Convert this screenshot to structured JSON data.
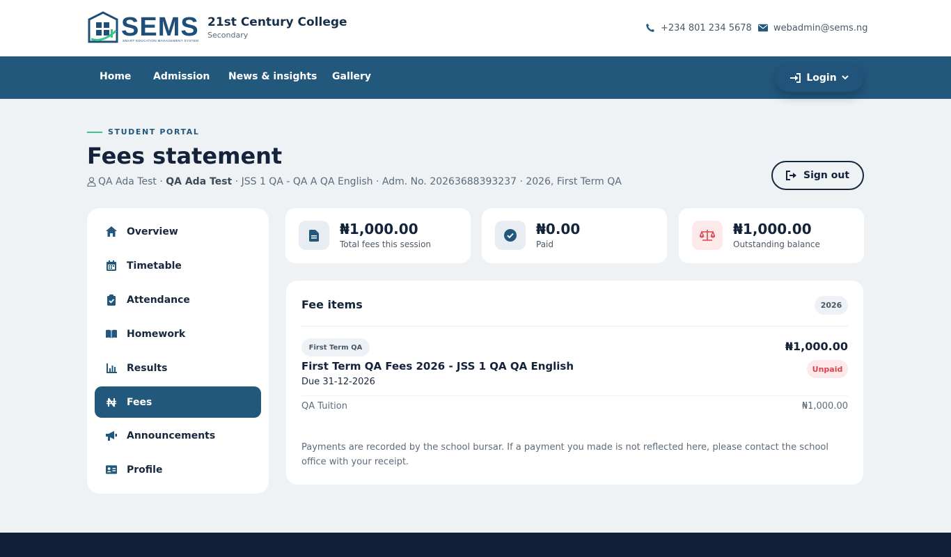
{
  "brand": {
    "logo_text": "SEMS",
    "logo_subtext": "SMART EDUCATION MANAGEMENT SYSTEM",
    "college_name": "21st Century College",
    "college_level": "Secondary"
  },
  "contact": {
    "phone": "+234 801 234 5678",
    "email": "webadmin@sems.ng"
  },
  "nav": {
    "items": [
      "Home",
      "Admission",
      "News & insights",
      "Gallery"
    ],
    "login_label": "Login"
  },
  "header": {
    "eyebrow": "STUDENT PORTAL",
    "title": "Fees statement",
    "student_name": "QA Ada Test",
    "student_name_bold": "QA Ada Test",
    "details": "· JSS 1 QA - QA A QA English · Adm. No. 20263688393237 · 2026, First Term QA",
    "signout_label": "Sign out"
  },
  "sidebar": {
    "items": [
      {
        "label": "Overview",
        "icon": "home-icon"
      },
      {
        "label": "Timetable",
        "icon": "calendar-icon"
      },
      {
        "label": "Attendance",
        "icon": "clipboard-check-icon"
      },
      {
        "label": "Homework",
        "icon": "book-open-icon"
      },
      {
        "label": "Results",
        "icon": "chart-bar-icon"
      },
      {
        "label": "Fees",
        "icon": "naira-icon",
        "active": true
      },
      {
        "label": "Announcements",
        "icon": "megaphone-icon"
      },
      {
        "label": "Profile",
        "icon": "id-card-icon"
      }
    ]
  },
  "stats": [
    {
      "amount": "₦1,000.00",
      "label": "Total fees this session",
      "icon": "document-icon"
    },
    {
      "amount": "₦0.00",
      "label": "Paid",
      "icon": "check-circle-icon"
    },
    {
      "amount": "₦1,000.00",
      "label": "Outstanding balance",
      "icon": "scale-icon"
    }
  ],
  "fee_items": {
    "title": "Fee items",
    "year": "2026",
    "entries": [
      {
        "term": "First Term QA",
        "title": "First Term QA Fees 2026 - JSS 1 QA QA English",
        "due": "Due 31-12-2026",
        "amount": "₦1,000.00",
        "status": "Unpaid",
        "lines": [
          {
            "label": "QA Tuition",
            "amount": "₦1,000.00"
          }
        ]
      }
    ],
    "note": "Payments are recorded by the school bursar. If a payment you made is not reflected here, please contact the school office with your receipt."
  },
  "colors": {
    "primary": "#23587d",
    "accent_green": "#3cc48a",
    "danger": "#d64550",
    "footer": "#121f38"
  }
}
